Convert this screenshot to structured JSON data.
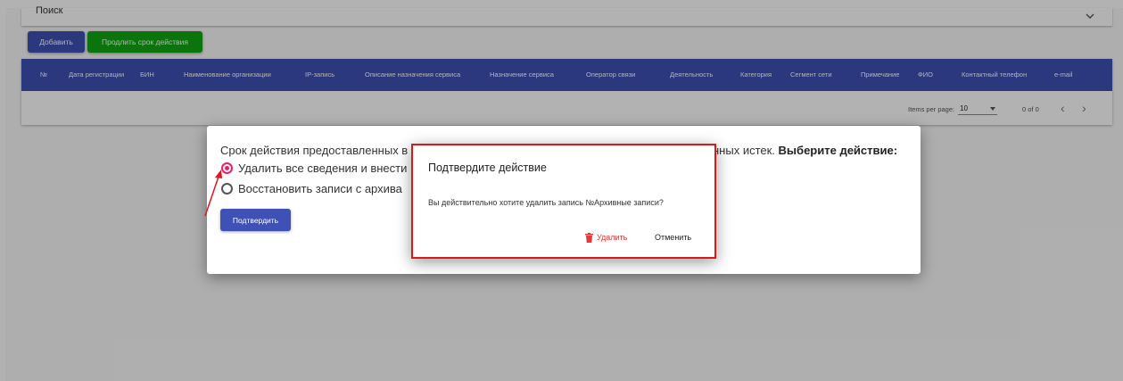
{
  "search": {
    "title": "Поиск"
  },
  "toolbar": {
    "add_label": "Добавить",
    "extend_label": "Продлить срок действия"
  },
  "table": {
    "columns": [
      "№",
      "Дата регистрации",
      "БИН",
      "Наименование организации",
      "IP-запись",
      "Описание назначения сервиса",
      "Назначение сервиса",
      "Оператор связи",
      "Деятельность",
      "Категория",
      "Сегмент сети",
      "Примечание",
      "ФИО",
      "Контактный телефон",
      "e-mail"
    ]
  },
  "paginator": {
    "items_per_page_label": "Items per page:",
    "page_size": "10",
    "range": "0 of 0"
  },
  "dialog1": {
    "text_left": "Срок действия предоставленных в",
    "text_right": "нных истек.",
    "text_emphasis": "Выберите действие:",
    "option_delete": "Удалить все сведения и внести",
    "option_restore": "Восстановить записи с архива",
    "confirm_label": "Подтвердить"
  },
  "dialog2": {
    "title": "Подтвердите действие",
    "message": "Вы действительно хотите удалить запись №Архивные записи?",
    "delete_label": "Удалить",
    "cancel_label": "Отменить"
  },
  "colors": {
    "primary": "#3f51b5",
    "success": "#12a712",
    "accent": "#e91e63",
    "danger": "#e53935",
    "highlight_border": "#e0161b"
  }
}
